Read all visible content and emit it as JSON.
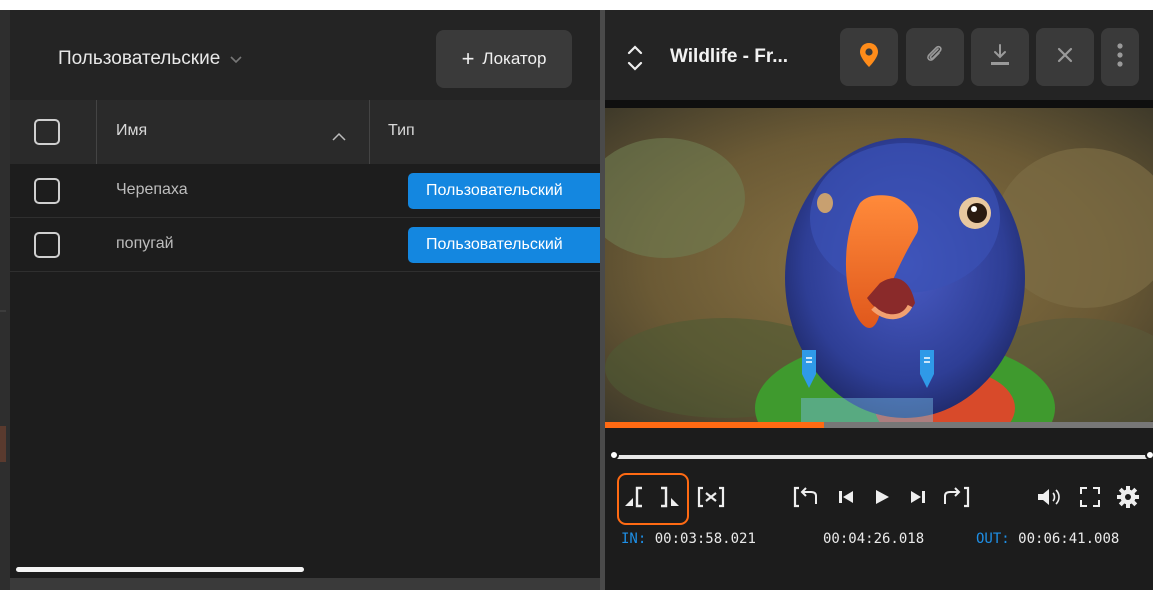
{
  "locators_panel": {
    "filter_label": "Пользовательские",
    "add_locator_plus": "+",
    "add_locator_label": "Локатор",
    "columns": {
      "name": "Имя",
      "type": "Тип"
    },
    "rows": [
      {
        "name": "Черепаха",
        "type": "Пользовательский"
      },
      {
        "name": "попугай",
        "type": "Пользовательский"
      }
    ]
  },
  "player": {
    "title": "Wildlife - Fr...",
    "progress_fraction": 0.4,
    "timecodes": {
      "in_label": "IN:",
      "in_value": "00:03:58.021",
      "current": "00:04:26.018",
      "out_label": "OUT:",
      "out_value": "00:06:41.008"
    },
    "icons": [
      "chevron-up-down-icon",
      "location-pin-icon",
      "link-icon",
      "download-icon",
      "close-icon",
      "more-vertical-icon",
      "mark-in-icon",
      "mark-out-icon",
      "clear-marks-icon",
      "go-to-in-icon",
      "step-back-icon",
      "play-icon",
      "step-forward-icon",
      "go-to-out-icon",
      "volume-icon",
      "fullscreen-icon",
      "settings-icon"
    ],
    "colors": {
      "accent": "#ff6a13",
      "badge": "#1487e0",
      "timecode_label": "#1e8fe6"
    }
  }
}
